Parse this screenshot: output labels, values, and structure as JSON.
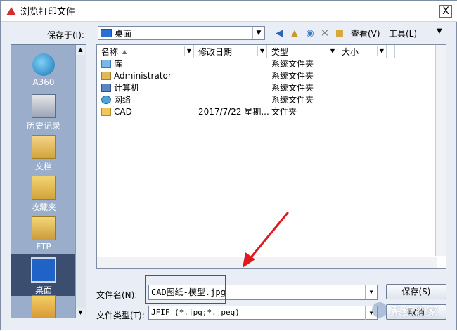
{
  "window": {
    "title": "浏览打印文件",
    "close_label": "X"
  },
  "toolbar": {
    "save_in_label": "保存于(I):",
    "location_value": "桌面",
    "view_label": "查看(V)",
    "tools_label": "工具(L)"
  },
  "places": [
    {
      "label": "A360",
      "icon": "a360-icon"
    },
    {
      "label": "历史记录",
      "icon": "history-icon"
    },
    {
      "label": "文档",
      "icon": "documents-icon"
    },
    {
      "label": "收藏夹",
      "icon": "favorites-icon"
    },
    {
      "label": "FTP",
      "icon": "ftp-icon"
    },
    {
      "label": "桌面",
      "icon": "desktop-icon",
      "selected": true
    }
  ],
  "columns": {
    "name": "名称",
    "date": "修改日期",
    "type": "类型",
    "size": "大小"
  },
  "files": [
    {
      "name": "库",
      "date": "",
      "type": "系统文件夹",
      "icon": "library-icon"
    },
    {
      "name": "Administrator",
      "date": "",
      "type": "系统文件夹",
      "icon": "user-folder-icon"
    },
    {
      "name": "计算机",
      "date": "",
      "type": "系统文件夹",
      "icon": "computer-icon"
    },
    {
      "name": "网络",
      "date": "",
      "type": "系统文件夹",
      "icon": "network-icon"
    },
    {
      "name": "CAD",
      "date": "2017/7/22 星期...",
      "type": "文件夹",
      "icon": "folder-icon"
    }
  ],
  "form": {
    "filename_label": "文件名(N):",
    "filename_value": "CAD图纸-模型.jpg",
    "filetype_label": "文件类型(T):",
    "filetype_value": "JFIF (*.jpg;*.jpeg)",
    "save_label": "保存(S)",
    "cancel_label": "取消"
  },
  "watermark": {
    "text": "系统之家"
  },
  "colors": {
    "highlight": "#e0191f",
    "places_bg": "#9aaecb",
    "dialog_bg": "#e9eef6"
  }
}
